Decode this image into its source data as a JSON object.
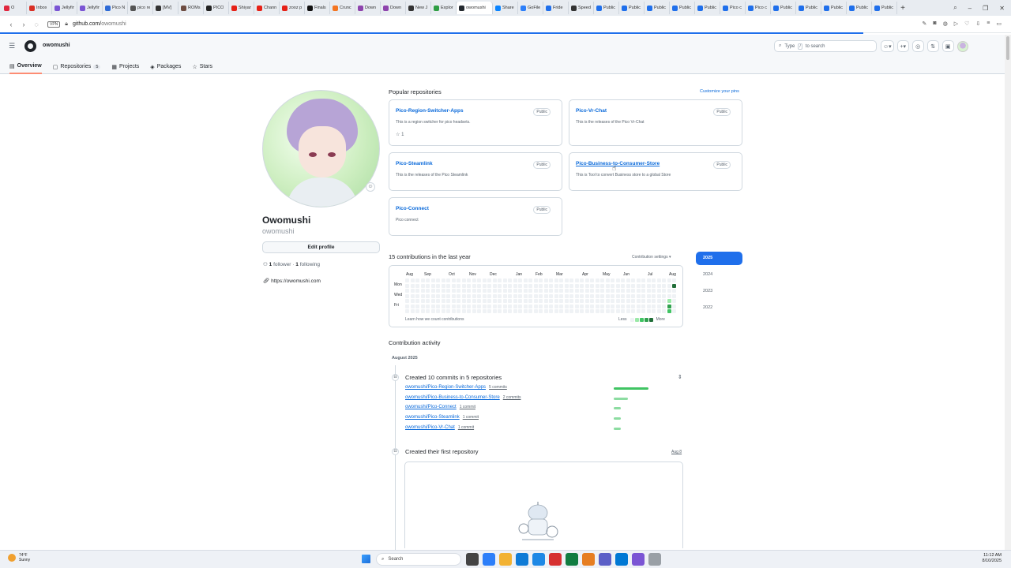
{
  "browser": {
    "tabs": [
      {
        "label": "O",
        "color": "#e0263e"
      },
      {
        "label": "Inbox",
        "color": "#d93025"
      },
      {
        "label": "Jellyfin",
        "color": "#7b55d4"
      },
      {
        "label": "Jellyfin",
        "color": "#7b55d4"
      },
      {
        "label": "Pico N",
        "color": "#2e6bd6"
      },
      {
        "label": "pico re",
        "color": "#555555"
      },
      {
        "label": "[MV]",
        "color": "#333333"
      },
      {
        "label": "ROMs",
        "color": "#6d4c41"
      },
      {
        "label": "PICO",
        "color": "#222222"
      },
      {
        "label": "Shiyan",
        "color": "#e62117"
      },
      {
        "label": "Chann",
        "color": "#e62117"
      },
      {
        "label": "zooz p",
        "color": "#e62117"
      },
      {
        "label": "Finals",
        "color": "#111111"
      },
      {
        "label": "Crunc",
        "color": "#f47521"
      },
      {
        "label": "Down",
        "color": "#8e44ad"
      },
      {
        "label": "Down",
        "color": "#8e44ad"
      },
      {
        "label": "New J",
        "color": "#333333"
      },
      {
        "label": "Explor",
        "color": "#2f9e44"
      },
      {
        "label": "owomushi",
        "color": "#24292f",
        "active": true
      },
      {
        "label": "Share",
        "color": "#0a84ff"
      },
      {
        "label": "GoFile",
        "color": "#2d7ff9"
      },
      {
        "label": "Fride",
        "color": "#1f6feb"
      },
      {
        "label": "Speed",
        "color": "#333333"
      },
      {
        "label": "Public",
        "color": "#1f6feb"
      },
      {
        "label": "Public",
        "color": "#1f6feb"
      },
      {
        "label": "Public",
        "color": "#1f6feb"
      },
      {
        "label": "Public",
        "color": "#1f6feb"
      },
      {
        "label": "Public",
        "color": "#1f6feb"
      },
      {
        "label": "Pico c",
        "color": "#1f6feb"
      },
      {
        "label": "Pico c",
        "color": "#1f6feb"
      },
      {
        "label": "Public",
        "color": "#1f6feb"
      },
      {
        "label": "Public",
        "color": "#1f6feb"
      },
      {
        "label": "Public",
        "color": "#1f6feb"
      },
      {
        "label": "Public",
        "color": "#1f6feb"
      },
      {
        "label": "Public",
        "color": "#1f6feb"
      }
    ],
    "new_tab": "+",
    "address": {
      "vpn": "VPN",
      "host": "github.com/",
      "path": "owomushi"
    }
  },
  "github": {
    "username": "owomushi",
    "search_placeholder": "Type",
    "search_kbd": "/",
    "search_suffix": "to search",
    "tabs": [
      {
        "label": "Overview",
        "selected": true
      },
      {
        "label": "Repositories",
        "count": "5"
      },
      {
        "label": "Projects"
      },
      {
        "label": "Packages"
      },
      {
        "label": "Stars"
      }
    ]
  },
  "profile": {
    "name": "Owomushi",
    "login": "owomushi",
    "edit_button": "Edit profile",
    "followers_count": "1",
    "followers_label": "follower",
    "following_count": "1",
    "following_label": "following",
    "website": "https://owomushi.com"
  },
  "popular": {
    "title": "Popular repositories",
    "customize": "Customize your pins",
    "repos": [
      {
        "name": "Pico-Region-Switcher-Apps",
        "badge": "Public",
        "desc": "This is a region switcher for pico headsets.",
        "stars": "1"
      },
      {
        "name": "Pico-Vr-Chat",
        "badge": "Public",
        "desc": "This is the releases of the Pico Vr-Chat"
      },
      {
        "name": "Pico-Steamlink",
        "badge": "Public",
        "desc": "This is the releases of the Pico Steamlink"
      },
      {
        "name": "Pico-Business-to-Consumer-Store",
        "badge": "Public",
        "desc": "This is Tool to convert Business store to a global Store"
      },
      {
        "name": "Pico-Connect",
        "badge": "Public",
        "desc": "Pico connect"
      }
    ]
  },
  "contributions": {
    "title": "15 contributions in the last year",
    "settings": "Contribution settings",
    "months": [
      "Aug",
      "Sep",
      "Oct",
      "Nov",
      "Dec",
      "Jan",
      "Feb",
      "Mar",
      "Apr",
      "May",
      "Jun",
      "Jul",
      "Aug"
    ],
    "days": [
      "Mon",
      "Wed",
      "Fri"
    ],
    "learn": "Learn how we count contributions",
    "legend_less": "Less",
    "legend_more": "More",
    "legend_colors": [
      "#eff2f5",
      "#9be9a8",
      "#40c463",
      "#30a14e",
      "#216e39"
    ],
    "active_cells": [
      {
        "week": 52,
        "day": 1,
        "level": 4
      },
      {
        "week": 51,
        "day": 4,
        "level": 1
      },
      {
        "week": 51,
        "day": 5,
        "level": 3
      },
      {
        "week": 51,
        "day": 6,
        "level": 2
      }
    ],
    "years": [
      "2025",
      "2024",
      "2023",
      "2022"
    ],
    "selected_year": "2025"
  },
  "activity": {
    "title": "Contribution activity",
    "month": "August 2025",
    "commits_title": "Created 10 commits in 5 repositories",
    "commit_rows": [
      {
        "repo": "owomushi/Pico-Region-Switcher-Apps",
        "count": "5 commits",
        "commits": 5
      },
      {
        "repo": "owomushi/Pico-Business-to-Consumer-Store",
        "count": "2 commits",
        "commits": 2
      },
      {
        "repo": "owomushi/Pico-Connect",
        "count": "1 commit",
        "commits": 1
      },
      {
        "repo": "owomushi/Pico-Steamlink",
        "count": "1 commit",
        "commits": 1
      },
      {
        "repo": "owomushi/Pico-Vr-Chat",
        "count": "1 commit",
        "commits": 1
      }
    ],
    "first_repo_title": "Created their first repository",
    "first_repo_date": "Aug 8"
  },
  "taskbar": {
    "temp": "74°F",
    "weather": "Sunny",
    "search": "Search",
    "time": "11:12 AM",
    "date": "8/10/2025",
    "app_colors": [
      "#444444",
      "#2d7ff9",
      "#f2b233",
      "#0f7bd6",
      "#1e88e5",
      "#d63031",
      "#107c41",
      "#e67e22",
      "#5b5fc7",
      "#0078d4",
      "#7b55d4",
      "#9aa0a6"
    ]
  }
}
